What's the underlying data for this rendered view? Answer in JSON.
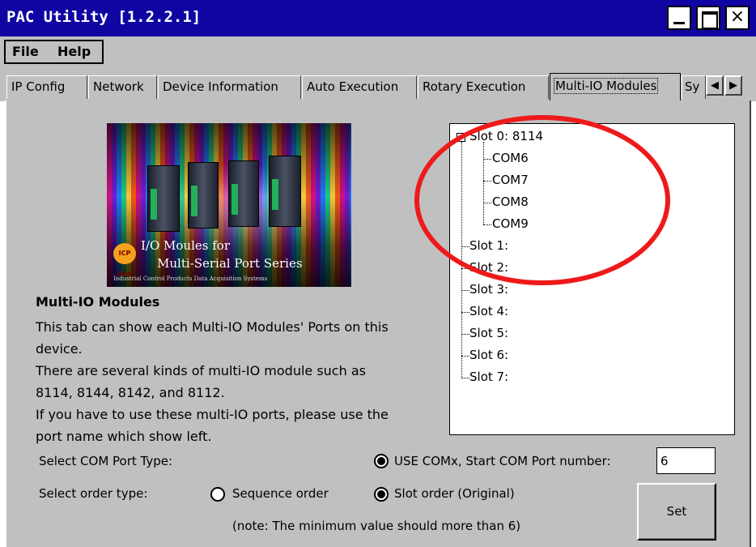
{
  "window": {
    "title": "PAC Utility  [1.2.2.1]",
    "buttons": {
      "minimize": "",
      "maximize": "",
      "close": "×"
    }
  },
  "menu": {
    "items": [
      "File",
      "Help"
    ]
  },
  "tabs": {
    "items": [
      "IP Config",
      "Network",
      "Device Information",
      "Auto Execution",
      "Rotary Execution",
      "Multi-IO Modules",
      "Sy"
    ],
    "active": "Multi-IO Modules",
    "scroll_left": "◀",
    "scroll_right": "▶"
  },
  "banner": {
    "logo_text": "ICP DAS",
    "line1": "I/O Moules for",
    "line2": "Multi-Serial Port Series",
    "line3": "Industrial Control Products Data Acquisition Systems"
  },
  "main": {
    "section_title": "Multi-IO Modules",
    "description": [
      "This tab can show each Multi-IO Modules' Ports on this",
      "device.",
      "There are several kinds of multi-IO module such as",
      "8114, 8144, 8142, and 8112.",
      "If you have to use these multi-IO ports, please use the",
      "port name which show left."
    ]
  },
  "tree": {
    "expander": "−",
    "slot0": {
      "label": "Slot 0: 8114",
      "ports": [
        "COM6",
        "COM7",
        "COM8",
        "COM9"
      ]
    },
    "slots": [
      "Slot 1:",
      "Slot 2:",
      "Slot 3:",
      "Slot 4:",
      "Slot 5:",
      "Slot 6:",
      "Slot 7:"
    ]
  },
  "settings": {
    "com_type_label": "Select COM Port Type:",
    "use_comx_label": "USE COMx, Start COM Port number:",
    "start_com_number": "6",
    "order_type_label": "Select order type:",
    "sequence_order_label": "Sequence order",
    "slot_order_label": "Slot order (Original)",
    "note": "(note: The minimum value should more than 6)",
    "set_button": "Set",
    "selected": {
      "use_comx": true,
      "sequence_order": false,
      "slot_order": true
    }
  },
  "annotation": {
    "color": "#ee1a1a"
  },
  "colors": {
    "titlebar": "#1005a3",
    "face": "#c0c0c0"
  }
}
